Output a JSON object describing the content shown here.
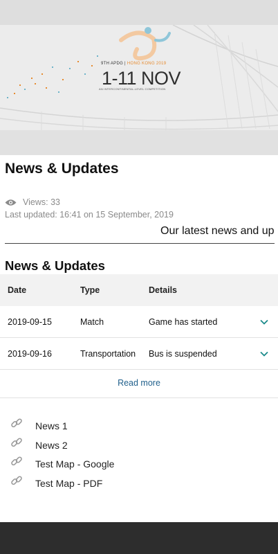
{
  "banner": {
    "subtitle_left": "9TH APDG | ",
    "subtitle_highlight": "HONG KONG 2019",
    "dates": "1-11 NOV",
    "tagline": "AN INTERCONTINENTAL-LEVEL COMPETITION",
    "colors": {
      "accent": "#e68a2e",
      "secondary": "#6db3c9"
    }
  },
  "page": {
    "title": "News & Updates",
    "views_label": "Views: 33",
    "last_updated": "Last updated: 16:41 on 15 September, 2019",
    "marquee": "Our latest news and up"
  },
  "news": {
    "title": "News & Updates",
    "headers": [
      "Date",
      "Type",
      "Details"
    ],
    "rows": [
      {
        "date": "2019-09-15",
        "type": "Match",
        "details": "Game has started"
      },
      {
        "date": "2019-09-16",
        "type": "Transportation",
        "details": "Bus is suspended"
      }
    ],
    "read_more": "Read more"
  },
  "links": [
    {
      "label": "News 1",
      "icon": "link-icon"
    },
    {
      "label": "News 2",
      "icon": "link-icon"
    },
    {
      "label": "Test Map - Google",
      "icon": "link-icon"
    },
    {
      "label": "Test Map - PDF",
      "icon": "link-icon"
    }
  ],
  "colors": {
    "link": "#1f5f8b",
    "chevron": "#1a8a8a",
    "footer": "#2d2d2d",
    "muted": "#8a8a8a"
  }
}
